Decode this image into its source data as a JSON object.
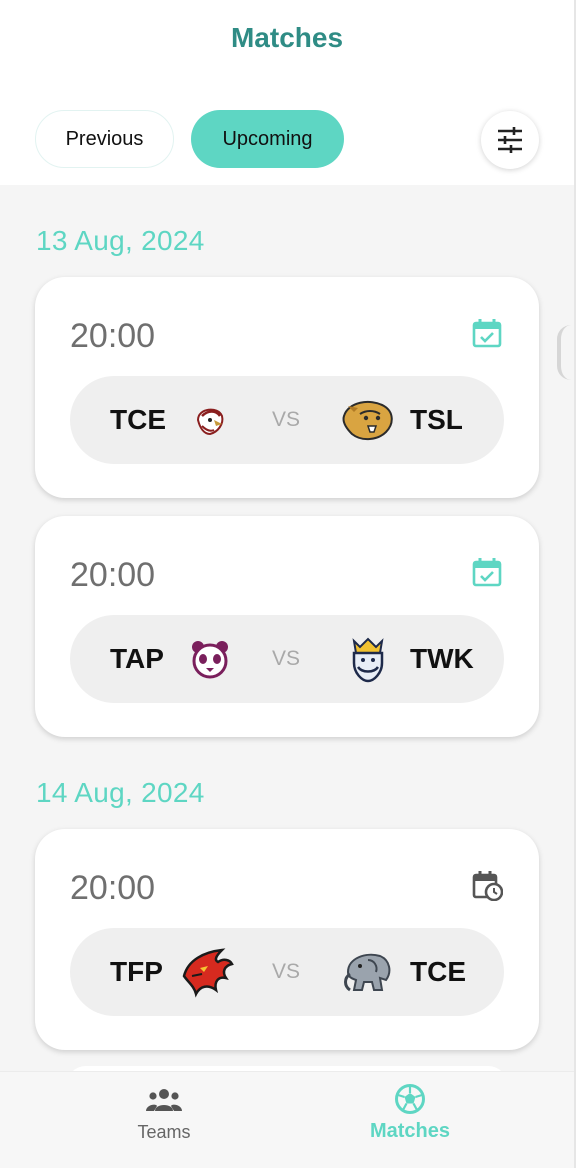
{
  "header": {
    "title": "Matches",
    "tabs": [
      {
        "label": "Previous",
        "selected": false
      },
      {
        "label": "Upcoming",
        "selected": true
      }
    ],
    "filter_icon": "sliders-icon"
  },
  "sections": [
    {
      "date": "13 Aug, 2024",
      "matches": [
        {
          "time": "20:00",
          "status_icon": "calendar-check-icon",
          "home": {
            "code": "TCE",
            "logo": "eagle-logo"
          },
          "vs": "VS",
          "away": {
            "code": "TSL",
            "logo": "lion-logo"
          }
        },
        {
          "time": "20:00",
          "status_icon": "calendar-check-icon",
          "home": {
            "code": "TAP",
            "logo": "panda-logo"
          },
          "vs": "VS",
          "away": {
            "code": "TWK",
            "logo": "king-logo"
          }
        }
      ]
    },
    {
      "date": "14 Aug, 2024",
      "matches": [
        {
          "time": "20:00",
          "status_icon": "calendar-clock-icon",
          "home": {
            "code": "TFP",
            "logo": "phoenix-logo"
          },
          "vs": "VS",
          "away": {
            "code": "TCE",
            "logo": "elephant-logo"
          }
        }
      ]
    }
  ],
  "bottom_nav": {
    "items": [
      {
        "label": "Teams",
        "icon": "group-icon",
        "active": false
      },
      {
        "label": "Matches",
        "icon": "soccer-ball-icon",
        "active": true
      }
    ]
  },
  "colors": {
    "accent": "#5ed6c3",
    "title": "#2f8c85",
    "inactive": "#666666"
  }
}
